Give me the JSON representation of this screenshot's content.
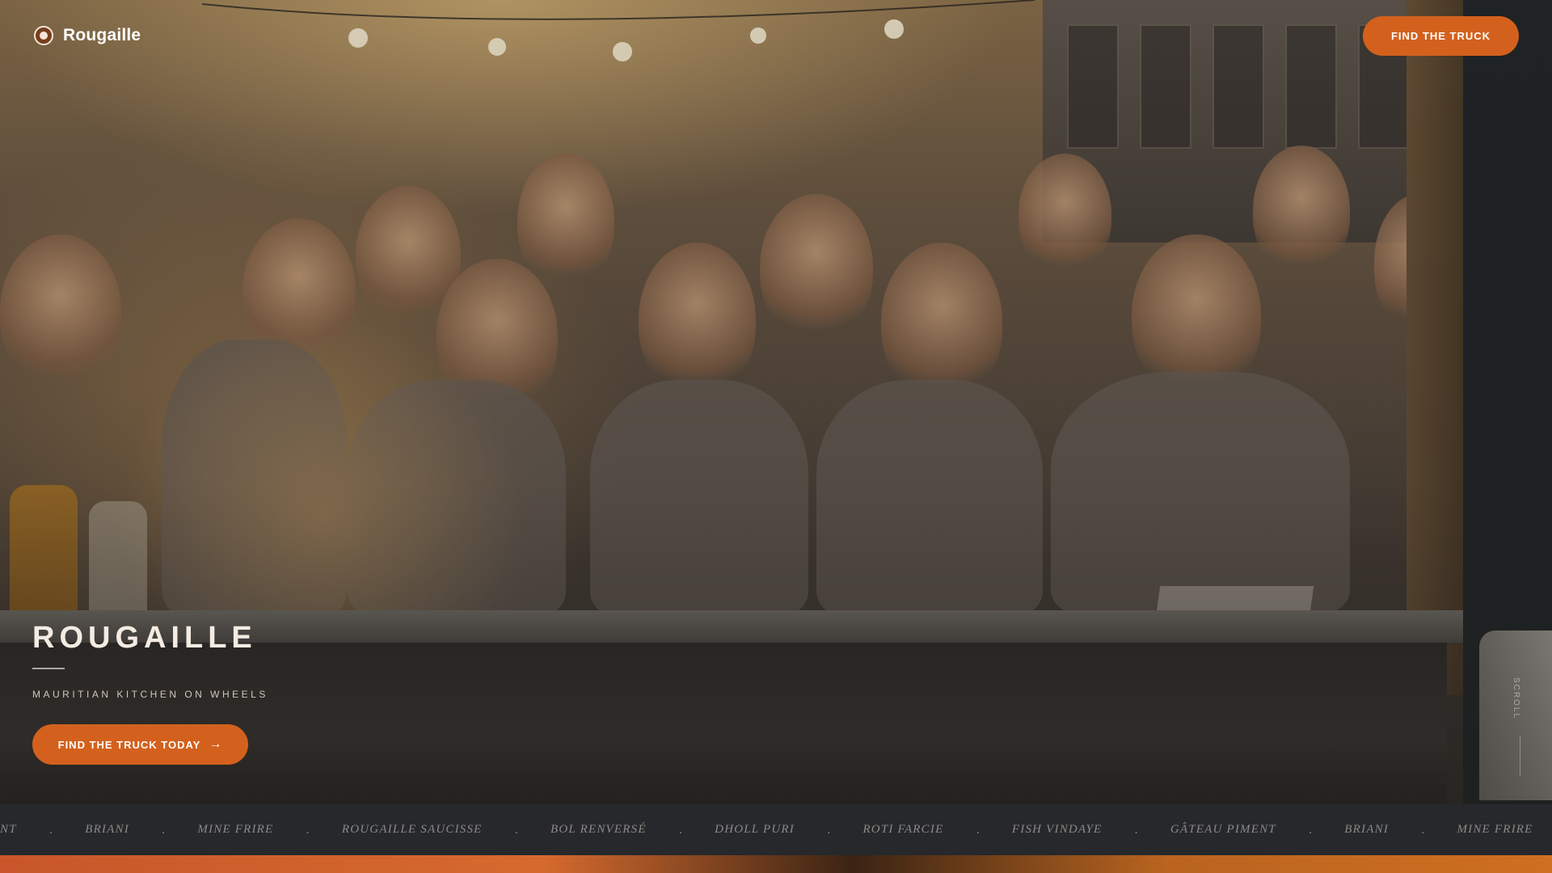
{
  "header": {
    "brand": "Rougaille",
    "cta_label": "FIND THE TRUCK"
  },
  "hero": {
    "title": "ROUGAILLE",
    "subtitle": "MAURITIAN KITCHEN ON WHEELS",
    "cta_label": "FIND THE TRUCK TODAY",
    "scroll_label": "SCROLL"
  },
  "marquee": {
    "items": [
      "NT",
      "BRIANI",
      "MINE FRIRE",
      "ROUGAILLE SAUCISSE",
      "BOL RENVERSÉ",
      "DHOLL PURI",
      "ROTI FARCIE",
      "FISH VINDAYE",
      "GÂTEAU PIMENT",
      "BRIANI",
      "MINE FRIRE"
    ],
    "separator": "."
  },
  "colors": {
    "accent": "#d3611d",
    "marquee_bg": "#26282b"
  },
  "icons": {
    "brand": "sun-logo-icon",
    "cta_arrow": "arrow-right-icon"
  }
}
